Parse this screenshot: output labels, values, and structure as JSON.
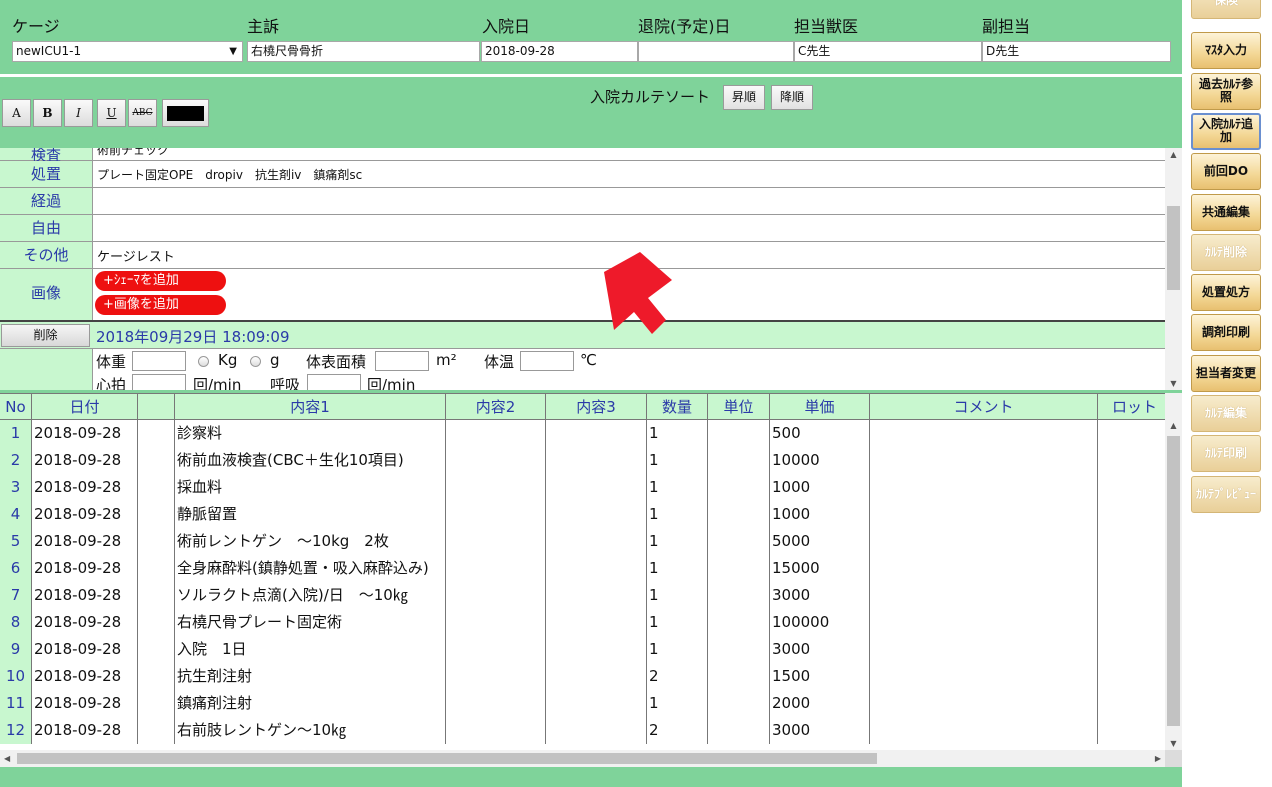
{
  "header": {
    "labels": {
      "cage": "ケージ",
      "complaint": "主訴",
      "admit_date": "入院日",
      "discharge_date": "退院(予定)日",
      "vet": "担当獣医",
      "sub_vet": "副担当"
    },
    "values": {
      "cage": "newICU1-1",
      "complaint": "右橈尺骨骨折",
      "admit_date": "2018-09-28",
      "discharge_date": "",
      "vet": "C先生",
      "sub_vet": "D先生"
    }
  },
  "toolbar": {
    "format_buttons": [
      "A",
      "B",
      "I",
      "U",
      "ABC"
    ],
    "sort_label": "入院カルテソート",
    "asc_label": "昇順",
    "desc_label": "降順"
  },
  "karte": {
    "rows": [
      {
        "label": "検査",
        "value": "術前チェック"
      },
      {
        "label": "処置",
        "value": "プレート固定OPE　dropiv　抗生剤iv　鎮痛剤sc"
      },
      {
        "label": "経過",
        "value": ""
      },
      {
        "label": "自由",
        "value": ""
      },
      {
        "label": "その他",
        "value": "ケージレスト"
      },
      {
        "label": "画像",
        "value": ""
      }
    ],
    "add_schema": "+ｼｪｰﾏを追加",
    "add_image": "+画像を追加",
    "delete_label": "削除",
    "timestamp": "2018年09月29日 18:09:09",
    "vitals": {
      "weight": "体重",
      "kg": "Kg",
      "g": "g",
      "bsa": "体表面積",
      "m2": "m²",
      "temp": "体温",
      "celsius": "℃",
      "pulse": "心拍",
      "pulse_unit": "回/min",
      "resp": "呼吸",
      "resp_unit": "回/min"
    }
  },
  "table": {
    "headers": [
      "No",
      "日付",
      "",
      "内容1",
      "内容2",
      "内容3",
      "数量",
      "単位",
      "単価",
      "コメント",
      "ロット"
    ],
    "rows": [
      {
        "no": "1",
        "date": "2018-09-28",
        "content1": "診察料",
        "qty": "1",
        "price": "500"
      },
      {
        "no": "2",
        "date": "2018-09-28",
        "content1": "術前血液検査(CBC＋生化10項目)",
        "qty": "1",
        "price": "10000"
      },
      {
        "no": "3",
        "date": "2018-09-28",
        "content1": "採血料",
        "qty": "1",
        "price": "1000"
      },
      {
        "no": "4",
        "date": "2018-09-28",
        "content1": "静脈留置",
        "qty": "1",
        "price": "1000"
      },
      {
        "no": "5",
        "date": "2018-09-28",
        "content1": "術前レントゲン　～10kg　2枚",
        "qty": "1",
        "price": "5000"
      },
      {
        "no": "6",
        "date": "2018-09-28",
        "content1": "全身麻酔料(鎮静処置・吸入麻酔込み)",
        "qty": "1",
        "price": "15000"
      },
      {
        "no": "7",
        "date": "2018-09-28",
        "content1": "ソルラクト点滴(入院)/日　～10㎏",
        "qty": "1",
        "price": "3000"
      },
      {
        "no": "8",
        "date": "2018-09-28",
        "content1": "右橈尺骨プレート固定術",
        "qty": "1",
        "price": "100000"
      },
      {
        "no": "9",
        "date": "2018-09-28",
        "content1": "入院　1日",
        "qty": "1",
        "price": "3000"
      },
      {
        "no": "10",
        "date": "2018-09-28",
        "content1": "抗生剤注射",
        "qty": "2",
        "price": "1500"
      },
      {
        "no": "11",
        "date": "2018-09-28",
        "content1": "鎮痛剤注射",
        "qty": "1",
        "price": "2000"
      },
      {
        "no": "12",
        "date": "2018-09-28",
        "content1": "右前肢レントゲン～10㎏",
        "qty": "2",
        "price": "3000"
      }
    ]
  },
  "sidebar": {
    "buttons": [
      {
        "label": "保険",
        "enabled": false
      },
      {
        "label": "ﾏｽﾀ入力",
        "enabled": true
      },
      {
        "label": "過去ｶﾙﾃ参照",
        "enabled": true
      },
      {
        "label": "入院ｶﾙﾃ追加",
        "enabled": true,
        "active": true
      },
      {
        "label": "前回DO",
        "enabled": true
      },
      {
        "label": "共通編集",
        "enabled": true
      },
      {
        "label": "ｶﾙﾃ削除",
        "enabled": false
      },
      {
        "label": "処置処方",
        "enabled": true
      },
      {
        "label": "調剤印刷",
        "enabled": true
      },
      {
        "label": "担当者変更",
        "enabled": true
      },
      {
        "label": "ｶﾙﾃ編集",
        "enabled": false
      },
      {
        "label": "ｶﾙﾃ印刷",
        "enabled": false
      },
      {
        "label": "ｶﾙﾃﾌﾟﾚﾋﾞｭｰ",
        "enabled": false
      }
    ]
  },
  "colors": {
    "background": "#7fd39a",
    "header_cell": "#c8f7cf",
    "label_text": "#2a3aa8",
    "pill": "#ee1010",
    "arrow": "#ee1a2a"
  }
}
